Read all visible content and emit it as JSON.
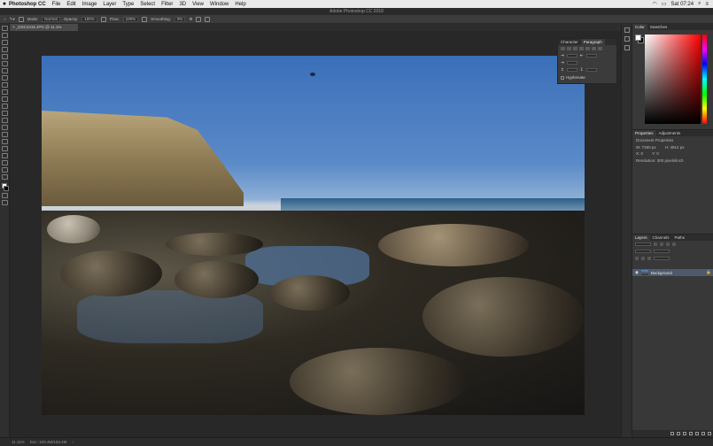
{
  "menubar": {
    "apple": "",
    "items": [
      "Photoshop CC",
      "File",
      "Edit",
      "Image",
      "Layer",
      "Type",
      "Select",
      "Filter",
      "3D",
      "View",
      "Window",
      "Help"
    ],
    "clock": "Sat 07:24"
  },
  "window": {
    "title": "Adobe Photoshop CC 2018"
  },
  "options": {
    "mode_label": "Mode:",
    "mode_value": "Normal",
    "opacity_label": "Opacity:",
    "opacity_value": "100%",
    "flow_label": "Flow:",
    "flow_value": "100%",
    "smoothing_label": "Smoothing:",
    "smoothing_value": "0%"
  },
  "document": {
    "tab_label": "_DSC4415.JPG @ 11.1% (RGB/8*)"
  },
  "float_panel": {
    "tabs": [
      "Character",
      "Paragraph"
    ],
    "active": 1,
    "hyphenate": "Hyphenate"
  },
  "color_panel": {
    "tabs": [
      "Color",
      "Swatches"
    ],
    "active": 0
  },
  "properties_panel": {
    "tabs": [
      "Properties",
      "Adjustments"
    ],
    "active": 0,
    "title": "Document Properties",
    "w": "W: 7360 px",
    "h": "H: 4912 px",
    "x": "X: 0",
    "y": "Y: 0",
    "resolution": "Resolution: 300 pixels/inch"
  },
  "layers_panel": {
    "tabs": [
      "Layers",
      "Channels",
      "Paths"
    ],
    "active": 0,
    "layer_name": "Background"
  },
  "status": {
    "zoom": "11.11%",
    "doc": "Doc: 103.4M/103.4M"
  },
  "colors": {
    "accent": "#4d5a6b",
    "foreground": "#ffffff",
    "background": "#000000"
  }
}
